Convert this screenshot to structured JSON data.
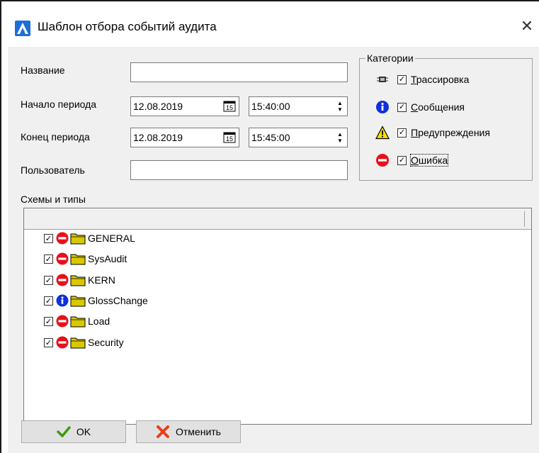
{
  "window": {
    "title": "Шаблон отбора событий аудита",
    "close_glyph": "✕"
  },
  "form": {
    "name_label": "Название",
    "name_value": "",
    "start_label": "Начало периода",
    "start_date": "12.08.2019",
    "start_time": "15:40:00",
    "end_label": "Конец периода",
    "end_date": "12.08.2019",
    "end_time": "15:45:00",
    "user_label": "Пользователь",
    "user_value": "",
    "calendar_glyph": "15"
  },
  "categories": {
    "legend": "Категории",
    "items": [
      {
        "icon": "trace-chip-icon",
        "checked": true,
        "label_first": "Т",
        "label_rest": "рассировка"
      },
      {
        "icon": "info-icon",
        "checked": true,
        "label_first": "С",
        "label_rest": "ообщения"
      },
      {
        "icon": "warning-icon",
        "checked": true,
        "label_first": "П",
        "label_rest": "редупреждения"
      },
      {
        "icon": "error-icon",
        "checked": true,
        "label_first": "О",
        "label_rest": "шибка"
      }
    ]
  },
  "schemes": {
    "label": "Схемы и типы",
    "items": [
      {
        "label": "GENERAL",
        "checked": true,
        "status": "error"
      },
      {
        "label": "SysAudit",
        "checked": true,
        "status": "error"
      },
      {
        "label": "KERN",
        "checked": true,
        "status": "error"
      },
      {
        "label": "GlossChange",
        "checked": true,
        "status": "info"
      },
      {
        "label": "Load",
        "checked": true,
        "status": "error"
      },
      {
        "label": "Security",
        "checked": true,
        "status": "error"
      }
    ]
  },
  "buttons": {
    "ok": "OK",
    "cancel": "Отменить"
  },
  "colors": {
    "accent": "#1e6fd6",
    "error": "#e8101a",
    "info": "#1030d8",
    "warning": "#ffe000",
    "folder": "#d8c800"
  }
}
